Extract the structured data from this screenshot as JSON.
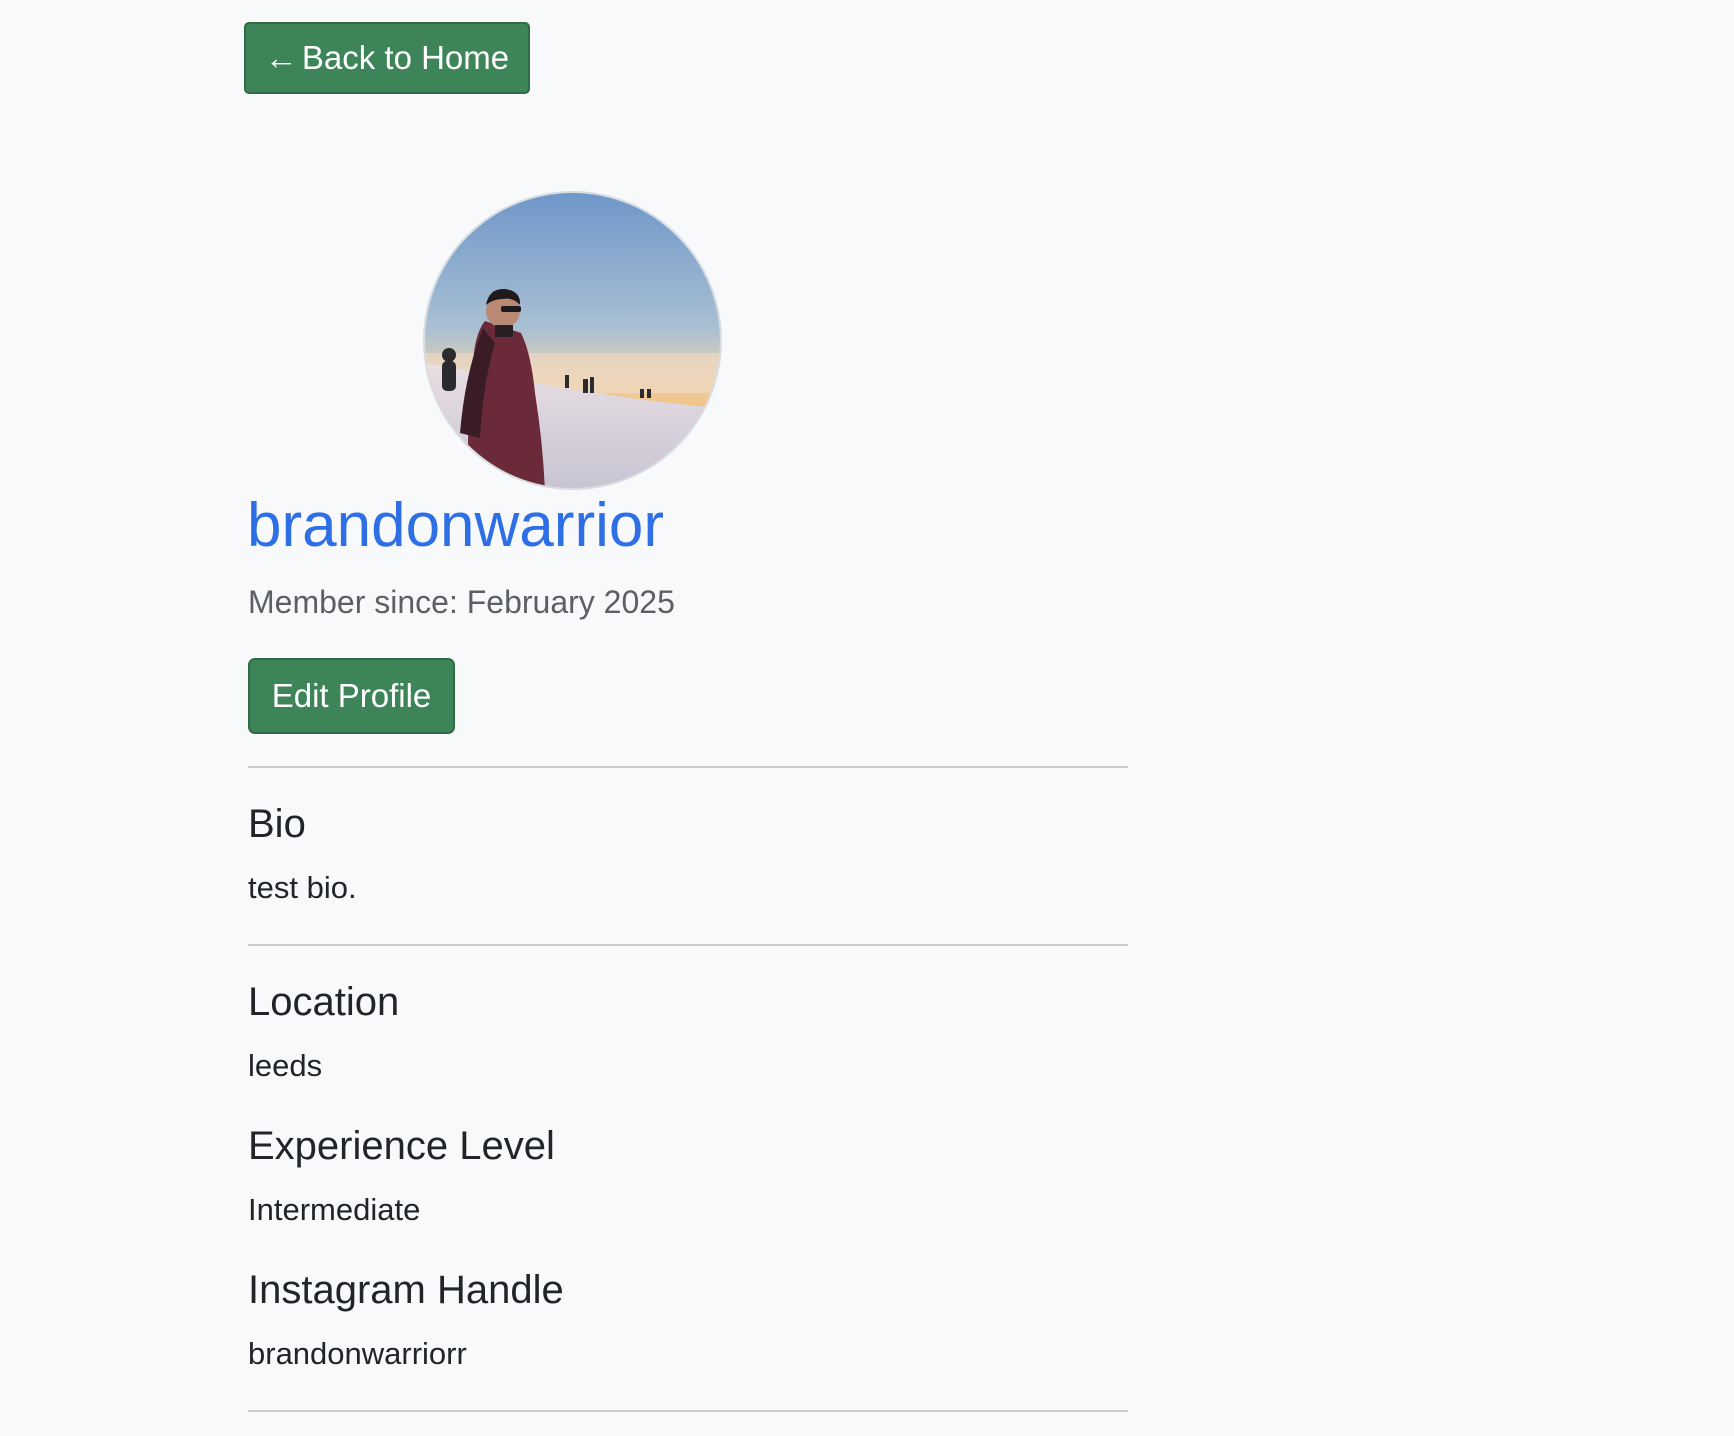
{
  "nav": {
    "back_arrow": "←",
    "back_label": "Back to Home"
  },
  "profile": {
    "username": "brandonwarrior",
    "member_since": "Member since: February 2025",
    "edit_label": "Edit Profile",
    "avatar_icon": "profile-photo"
  },
  "sections": {
    "bio": {
      "heading": "Bio",
      "value": "test bio."
    },
    "location": {
      "heading": "Location",
      "value": "leeds"
    },
    "experience": {
      "heading": "Experience Level",
      "value": "Intermediate"
    },
    "instagram": {
      "heading": "Instagram Handle",
      "value": "brandonwarriorr"
    }
  },
  "colors": {
    "accent_green": "#3d8558",
    "username_blue": "#2f6fe6",
    "background": "#f8f9fb"
  }
}
